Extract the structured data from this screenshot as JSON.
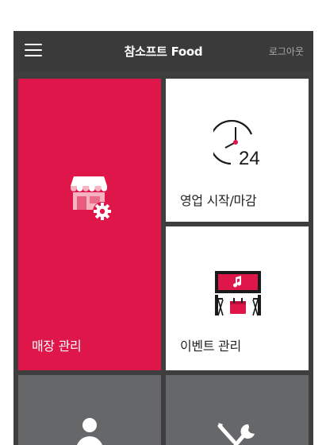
{
  "header": {
    "title": "참소프트 Food",
    "logout_label": "로그아웃"
  },
  "tiles": {
    "store_management": {
      "label": "매장 관리",
      "icon": "store-settings-icon",
      "color": "#de1649"
    },
    "business_hours": {
      "label": "영업 시작/마감",
      "icon": "clock-24-icon",
      "color": "#ffffff",
      "icon_text": "24"
    },
    "event_management": {
      "label": "이벤트 관리",
      "icon": "event-stage-icon",
      "color": "#ffffff"
    },
    "member": {
      "label": "",
      "icon": "person-icon",
      "color": "#666769"
    },
    "settings": {
      "label": "",
      "icon": "tools-icon",
      "color": "#666769"
    }
  },
  "colors": {
    "accent": "#de1649",
    "topbar": "#3a3a3a",
    "tile_dark": "#666769"
  }
}
